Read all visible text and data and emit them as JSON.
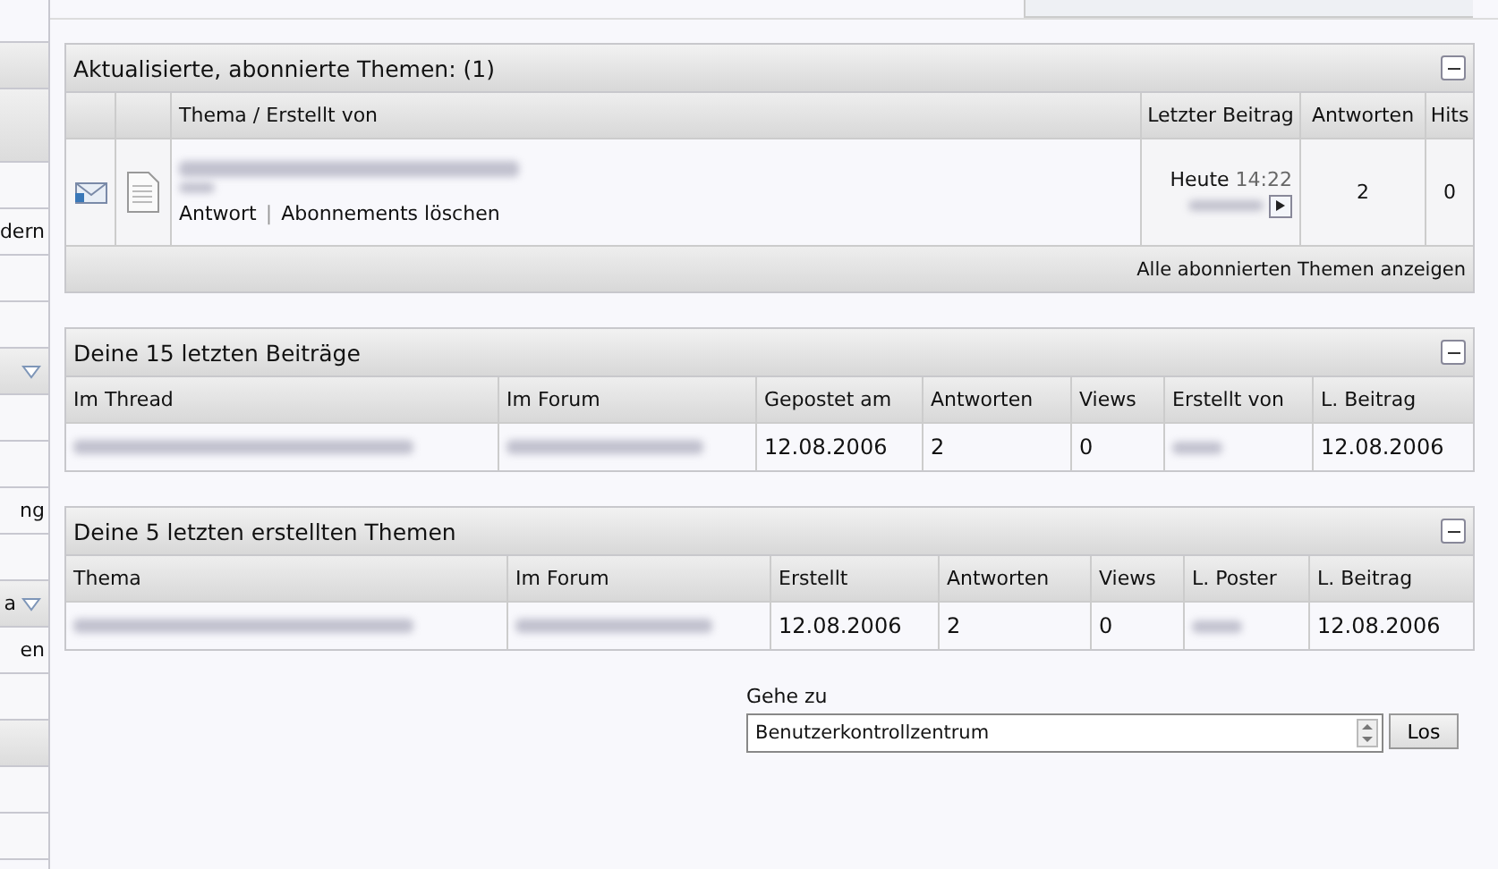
{
  "sidebar": {
    "rows": [
      {
        "kind": "header"
      },
      {
        "kind": "header"
      },
      {
        "kind": "plain"
      },
      {
        "kind": "plain",
        "text": "dern"
      },
      {
        "kind": "plain"
      },
      {
        "kind": "plain"
      },
      {
        "kind": "menu"
      },
      {
        "kind": "plain"
      },
      {
        "kind": "plain"
      },
      {
        "kind": "plain",
        "text": "ng"
      },
      {
        "kind": "plain"
      },
      {
        "kind": "menu",
        "text": "a"
      },
      {
        "kind": "plain",
        "text": "en"
      },
      {
        "kind": "plain"
      },
      {
        "kind": "header"
      },
      {
        "kind": "plain"
      },
      {
        "kind": "plain"
      }
    ]
  },
  "subscribed": {
    "title": "Aktualisierte, abonnierte Themen:",
    "count": "(1)",
    "columns": [
      "Thema / Erstellt von",
      "Letzter Beitrag",
      "Antworten",
      "Hits"
    ],
    "rows": [
      {
        "actions": [
          "Antwort",
          "Abonnements löschen"
        ],
        "separator": "|",
        "last_day": "Heute",
        "last_time": "14:22",
        "replies": "2",
        "hits": "0"
      }
    ],
    "footer_link": "Alle abonnierten Themen anzeigen"
  },
  "tables": [
    {
      "title": "Deine 15 letzten Beiträge",
      "columns": [
        "Im Thread",
        "Im Forum",
        "Gepostet am",
        "Antworten",
        "Views",
        "Erstellt von",
        "L. Beitrag"
      ],
      "rows": [
        [
          {
            "kind": "blurred"
          },
          {
            "kind": "blurred"
          },
          {
            "kind": "text",
            "text": "12.08.2006"
          },
          {
            "kind": "text",
            "text": "2"
          },
          {
            "kind": "text",
            "text": "0"
          },
          {
            "kind": "blurred-short"
          },
          {
            "kind": "text",
            "text": "12.08.2006"
          }
        ]
      ]
    },
    {
      "title": "Deine 5 letzten erstellten Themen",
      "columns": [
        "Thema",
        "Im Forum",
        "Erstellt",
        "Antworten",
        "Views",
        "L. Poster",
        "L. Beitrag"
      ],
      "rows": [
        [
          {
            "kind": "blurred"
          },
          {
            "kind": "blurred"
          },
          {
            "kind": "text",
            "text": "12.08.2006"
          },
          {
            "kind": "text",
            "text": "2"
          },
          {
            "kind": "text",
            "text": "0"
          },
          {
            "kind": "blurred-short"
          },
          {
            "kind": "text",
            "text": "12.08.2006"
          }
        ]
      ]
    }
  ],
  "jump": {
    "label": "Gehe zu",
    "value": "Benutzerkontrollzentrum",
    "button": "Los"
  }
}
